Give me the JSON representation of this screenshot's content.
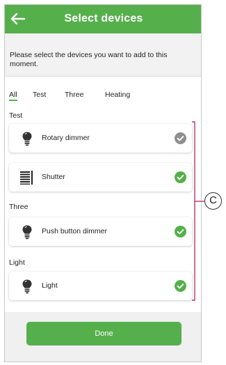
{
  "header": {
    "title": "Select devices",
    "back_icon": "arrow-left-icon"
  },
  "instruction": "Please select the devices you want to add to this moment.",
  "tabs": [
    {
      "label": "All",
      "active": true
    },
    {
      "label": "Test",
      "active": false
    },
    {
      "label": "Three",
      "active": false
    },
    {
      "label": "Heating",
      "active": false
    }
  ],
  "sections": [
    {
      "title": "Test",
      "devices": [
        {
          "label": "Rotary dimmer",
          "icon": "bulb-icon",
          "selected": false
        },
        {
          "label": "Shutter",
          "icon": "shutter-icon",
          "selected": true
        }
      ]
    },
    {
      "title": "Three",
      "devices": [
        {
          "label": "Push button dimmer",
          "icon": "bulb-icon",
          "selected": true
        }
      ]
    },
    {
      "title": "Light",
      "devices": [
        {
          "label": "Light",
          "icon": "bulb-icon",
          "selected": true
        }
      ]
    }
  ],
  "done_label": "Done",
  "callout": {
    "label": "C"
  },
  "colors": {
    "accent": "#55b04c",
    "check_selected": "#55b04c",
    "check_unselected": "#8f8f8f",
    "callout_bracket": "#c0306a"
  }
}
